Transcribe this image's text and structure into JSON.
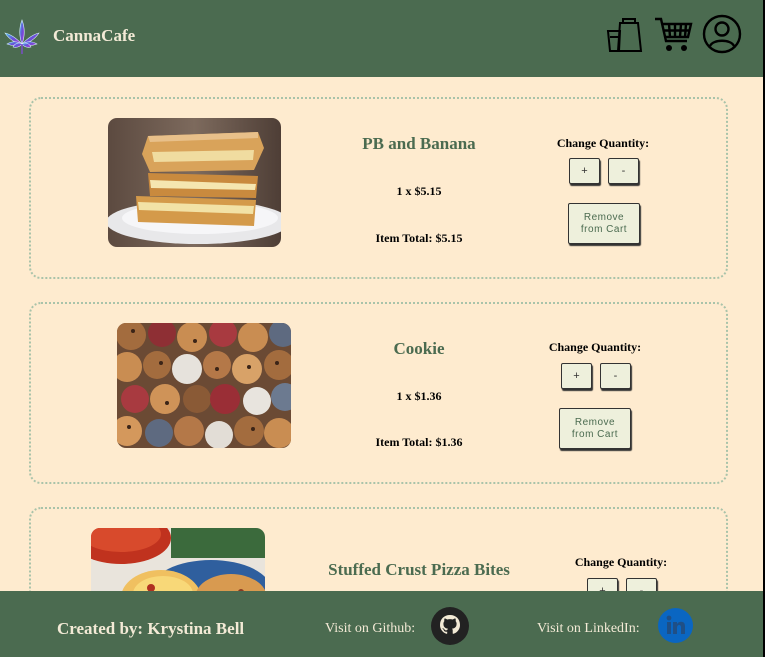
{
  "header": {
    "brand": "CannaCafe",
    "icons": [
      "cannabis-leaf-logo-icon",
      "coffee-bag-icon",
      "cart-icon",
      "user-account-icon"
    ]
  },
  "cart": {
    "change_quantity_label": "Change Quantity:",
    "plus_label": "+",
    "minus_label": "-",
    "remove_line1": "Remove",
    "remove_line2": "from Cart",
    "items": [
      {
        "name": "PB and Banana",
        "qty_price": "1 x $5.15",
        "total": "Item Total: $5.15"
      },
      {
        "name": "Cookie",
        "qty_price": "1 x $1.36",
        "total": "Item Total: $1.36"
      },
      {
        "name": "Stuffed Crust Pizza Bites"
      }
    ]
  },
  "footer": {
    "credit": "Created by: Krystina Bell",
    "github_label": "Visit on Github:",
    "linkedin_label": "Visit on LinkedIn:"
  },
  "colors": {
    "header_bg": "#4b6b50",
    "page_bg": "#feebcf",
    "accent_green": "#4b6b50",
    "card_border": "#a9c3aa",
    "button_bg": "#eef0dc",
    "linkedin_blue": "#0a66c2"
  }
}
